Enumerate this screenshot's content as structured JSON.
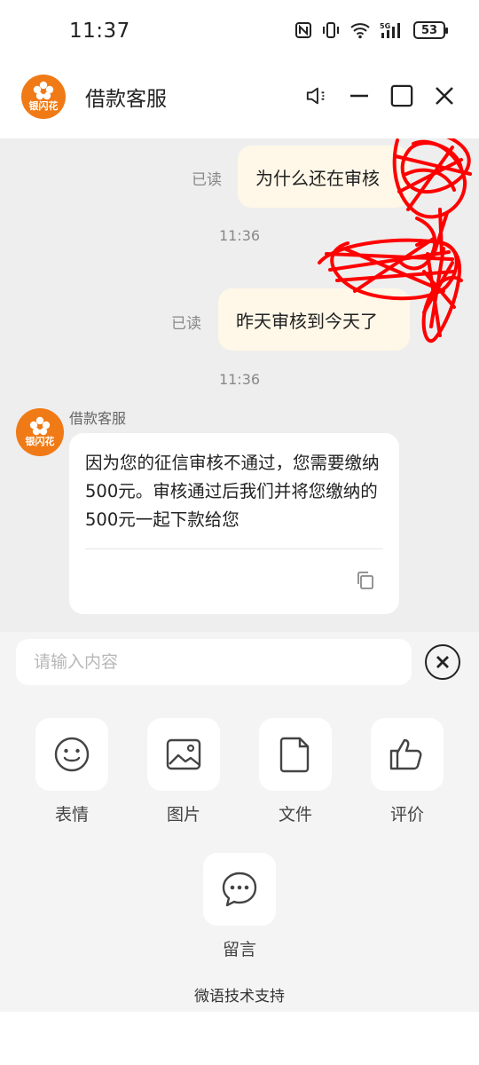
{
  "status_bar": {
    "time": "11:37",
    "battery": "53",
    "icons": [
      "nfc-icon",
      "vibrate-icon",
      "wifi-icon",
      "5g-signal-icon",
      "battery-icon"
    ]
  },
  "header": {
    "logo_text": "银闪花",
    "title": "借款客服",
    "actions": [
      "speaker-icon",
      "minimize-icon",
      "maximize-icon",
      "close-icon"
    ]
  },
  "chat": {
    "messages": [
      {
        "direction": "out",
        "read_label": "已读",
        "text": "为什么还在审核"
      },
      {
        "direction": "time",
        "text": "11:36"
      },
      {
        "direction": "out",
        "read_label": "已读",
        "text": "昨天审核到今天了"
      },
      {
        "direction": "time",
        "text": "11:36"
      }
    ],
    "agent": {
      "avatar_text": "银闪花",
      "name": "借款客服",
      "message": "因为您的征信审核不通过，您需要缴纳500元。审核通过后我们并将您缴纳的500元一起下款给您"
    }
  },
  "input": {
    "placeholder": "请输入内容",
    "value": ""
  },
  "tools": [
    {
      "label": "表情",
      "icon": "emoji-icon"
    },
    {
      "label": "图片",
      "icon": "image-icon"
    },
    {
      "label": "文件",
      "icon": "file-icon"
    },
    {
      "label": "评价",
      "icon": "thumbs-up-icon"
    },
    {
      "label": "留言",
      "icon": "message-icon"
    }
  ],
  "footer": {
    "support_text": "微语技术支持"
  },
  "colors": {
    "brand": "#f07a16",
    "chat_bg": "#eeeeee",
    "bubble_out": "#fff8e8",
    "scribble": "#ff0000"
  }
}
